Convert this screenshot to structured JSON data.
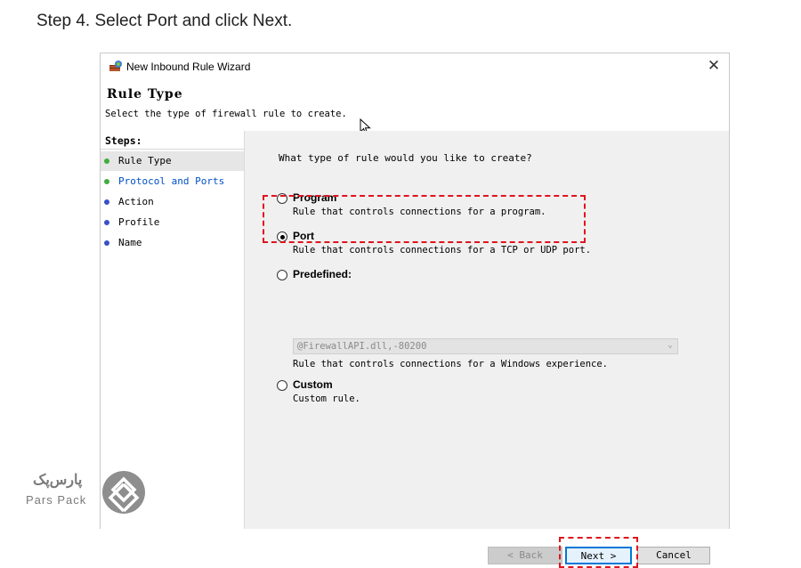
{
  "caption": "Step 4. Select Port and click Next.",
  "window": {
    "title": "New Inbound Rule Wizard",
    "close_glyph": "✕"
  },
  "header": {
    "title": "Rule Type",
    "subtitle": "Select the type of firewall rule to create."
  },
  "steps": {
    "label": "Steps:",
    "items": [
      {
        "label": "Rule Type",
        "dot_color": "#3fae3f",
        "active": true
      },
      {
        "label": "Protocol and Ports",
        "dot_color": "#3fae3f",
        "active": false,
        "link_color": "#0050c8"
      },
      {
        "label": "Action",
        "dot_color": "#3a50c8",
        "active": false
      },
      {
        "label": "Profile",
        "dot_color": "#3a50c8",
        "active": false
      },
      {
        "label": "Name",
        "dot_color": "#3a50c8",
        "active": false
      }
    ]
  },
  "content": {
    "question": "What type of rule would you like to create?",
    "options": [
      {
        "label": "Program",
        "desc": "Rule that controls connections for a program.",
        "checked": false
      },
      {
        "label": "Port",
        "desc": "Rule that controls connections for a TCP or UDP port.",
        "checked": true
      },
      {
        "label": "Predefined:",
        "desc": "",
        "checked": false
      },
      {
        "label": "Custom",
        "desc": "Custom rule.",
        "checked": false
      }
    ],
    "predefined": {
      "value": "@FirewallAPI.dll,-80200",
      "desc": "Rule that controls connections for a Windows experience."
    }
  },
  "buttons": {
    "back": "< Back",
    "next": "Next >",
    "cancel": "Cancel"
  },
  "logo": {
    "text_fa": "پارس‌پک",
    "text_en": "Pars Pack"
  },
  "colors": {
    "highlight": "#e0141e",
    "accent": "#0078d7"
  }
}
